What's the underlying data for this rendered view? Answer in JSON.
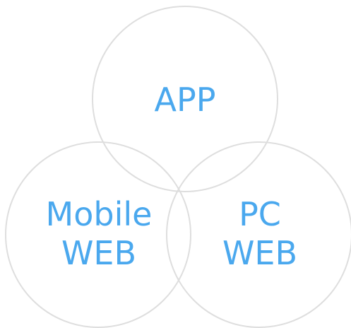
{
  "colors": {
    "label": "#4aa8ee",
    "circle_outline": "#dedede",
    "background": "#ffffff"
  },
  "venn": {
    "sets": [
      {
        "id": "app",
        "lines": [
          "APP"
        ]
      },
      {
        "id": "mobile-web",
        "lines": [
          "Mobile",
          "WEB"
        ]
      },
      {
        "id": "pc-web",
        "lines": [
          "PC",
          "WEB"
        ]
      }
    ]
  }
}
